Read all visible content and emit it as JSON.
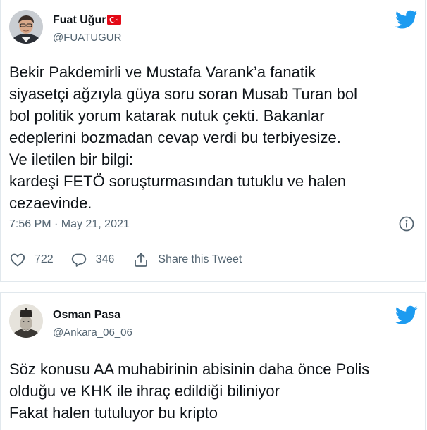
{
  "tweets": [
    {
      "author_name": "Fuat Uğur",
      "handle": "@FUATUGUR",
      "flag_icon": "turkey-flag-icon",
      "text_lines": [
        "Bekir Pakdemirli ve Mustafa Varank’a fanatik",
        "siyasetçi ağzıyla güya soru soran  Musab Turan bol",
        "bol politik yorum katarak nutuk çekti. Bakanlar",
        "edeplerini bozmadan cevap verdi bu terbiyesize.",
        "Ve iletilen bir bilgi:",
        "kardeşi FETÖ soruşturmasından tutuklu ve halen",
        "cezaevinde."
      ],
      "timestamp": "7:56 PM · May 21, 2021",
      "likes": "722",
      "replies": "346",
      "share_label": "Share this Tweet"
    },
    {
      "author_name": "Osman Pasa",
      "handle": "@Ankara_06_06",
      "text_lines": [
        "Söz konusu AA muhabirinin abisinin daha önce Polis",
        "olduğu ve KHK ile ihraç edildiği biliniyor",
        "Fakat halen tutuluyor bu kripto"
      ]
    }
  ],
  "icons": {
    "brand": "twitter-bird-icon",
    "info": "info-icon",
    "like": "heart-icon",
    "reply": "reply-icon",
    "share": "share-icon"
  },
  "colors": {
    "brand_blue": "#1d9bf0",
    "text": "#0f1419",
    "muted": "#536471",
    "border": "#e1e8ed",
    "flag_red": "#e30a17"
  }
}
